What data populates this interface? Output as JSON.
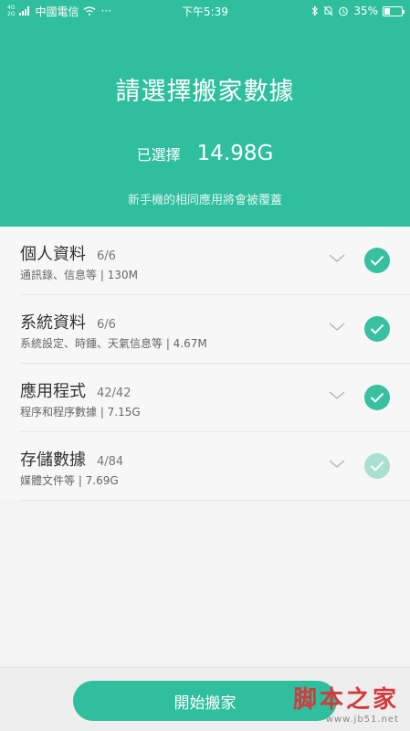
{
  "status_bar": {
    "network_tag": "4G\n2G",
    "carrier": "中國電信",
    "more": "···",
    "time": "下午5:39",
    "battery_percent": "35%",
    "battery_level": 0.35
  },
  "header": {
    "title": "請選擇搬家數據",
    "selected_label": "已選擇",
    "selected_value": "14.98G",
    "notice": "新手機的相同應用將會被覆蓋"
  },
  "items": [
    {
      "name": "個人資料",
      "count": "6/6",
      "desc": "通訊錄、信息等 | 130M",
      "checked": true
    },
    {
      "name": "系統資料",
      "count": "6/6",
      "desc": "系統設定、時鍾、天氣信息等 | 4.67M",
      "checked": true
    },
    {
      "name": "應用程式",
      "count": "42/42",
      "desc": "程序和程序數據 | 7.15G",
      "checked": true
    },
    {
      "name": "存儲數據",
      "count": "4/84",
      "desc": "媒體文件等 | 7.69G",
      "checked": "partial"
    }
  ],
  "bottom": {
    "start_label": "開始搬家"
  },
  "watermark": {
    "main": "脚本之家",
    "sub": "www.jb51.net"
  },
  "colors": {
    "accent": "#2fbf9e",
    "check": "#38c0a1",
    "check_partial": "#a9e0d2"
  }
}
